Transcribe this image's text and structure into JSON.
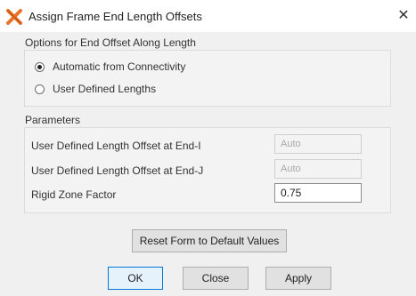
{
  "window": {
    "title": "Assign Frame End Length Offsets",
    "close_glyph": "✕",
    "app_icon": "x-frame-app-icon"
  },
  "offset_options": {
    "label": "Options for End Offset Along Length",
    "options": [
      {
        "label": "Automatic from Connectivity",
        "selected": true
      },
      {
        "label": "User Defined Lengths",
        "selected": false
      }
    ]
  },
  "parameters": {
    "label": "Parameters",
    "fields": [
      {
        "label": "User Defined Length Offset at End-I",
        "value": "Auto",
        "enabled": false
      },
      {
        "label": "User Defined Length Offset at End-J",
        "value": "Auto",
        "enabled": false
      },
      {
        "label": "Rigid Zone Factor",
        "value": "0.75",
        "enabled": true
      }
    ]
  },
  "buttons": {
    "reset": "Reset Form to Default Values",
    "ok": "OK",
    "close": "Close",
    "apply": "Apply"
  },
  "colors": {
    "accent": "#0078d7",
    "app_icon": "#e8722a"
  }
}
